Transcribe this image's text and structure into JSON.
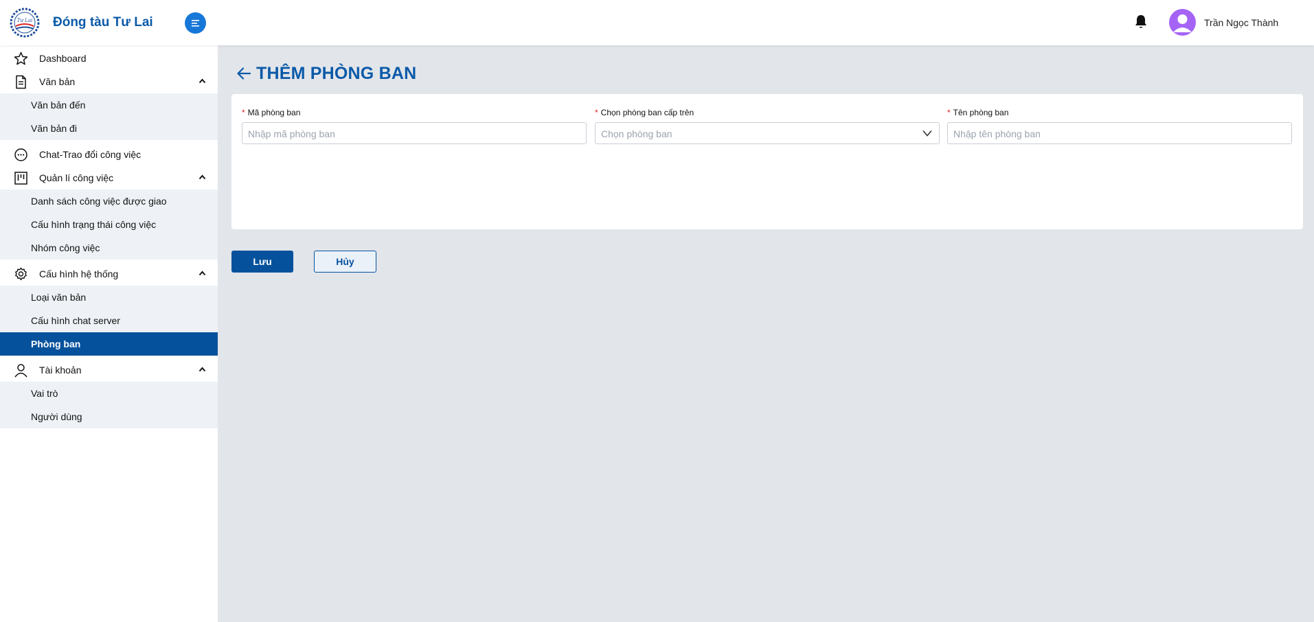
{
  "header": {
    "app_title": "Đóng tàu Tư Lai",
    "logo_icon": "ship-logo",
    "user_name": "Trần Ngọc Thành",
    "accent": "#0a5aa8"
  },
  "sidebar": {
    "groups": [
      {
        "label": "Dashboard",
        "icon": "star-icon"
      },
      {
        "label": "Văn bản",
        "icon": "document-icon",
        "items": [
          "Văn bản đến",
          "Văn bản đi"
        ]
      },
      {
        "label": "Chat-Trao đổi công việc",
        "icon": "chat-icon"
      },
      {
        "label": "Quản lí công việc",
        "icon": "board-icon",
        "items": [
          "Danh sách công việc được giao",
          "Cấu hình trạng thái công việc",
          "Nhóm công việc"
        ]
      },
      {
        "label": "Cấu hình hệ thống",
        "icon": "gear-icon",
        "items": [
          "Loại văn bản",
          "Cấu hình chat server",
          "Phòng ban"
        ],
        "active_item": "Phòng ban"
      },
      {
        "label": "Tài khoản",
        "icon": "user-icon",
        "items": [
          "Vai trò",
          "Người dùng"
        ]
      }
    ]
  },
  "page": {
    "title": "THÊM PHÒNG BAN",
    "fields": [
      {
        "label": "Mã phòng ban",
        "required_mark": "*",
        "placeholder": "Nhập mã phòng ban"
      },
      {
        "label": "Chọn phòng ban cấp trên",
        "required_mark": "*",
        "placeholder": "Chọn phòng ban"
      },
      {
        "label": "Tên phòng ban",
        "required_mark": "*",
        "placeholder": "Nhập tên phòng ban"
      }
    ],
    "save_label": "Lưu",
    "cancel_label": "Hủy"
  }
}
